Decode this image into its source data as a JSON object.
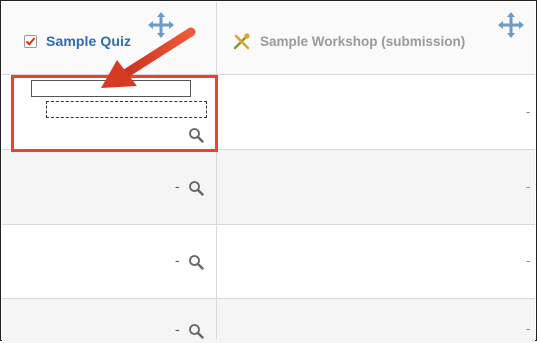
{
  "columns": {
    "quiz": {
      "title": "Sample Quiz",
      "icon": "checkbox-quiz-icon"
    },
    "workshop": {
      "title": "Sample Workshop (submission)",
      "icon": "workshop-icon"
    }
  },
  "rows": [
    {
      "quiz_value": "",
      "workshop_value": "-"
    },
    {
      "quiz_value": "-",
      "workshop_value": "-"
    },
    {
      "quiz_value": "-",
      "workshop_value": "-"
    },
    {
      "quiz_value": "-",
      "workshop_value": "-"
    }
  ],
  "colors": {
    "quiz_title": "#2a6cb5",
    "workshop_title": "#9a9a9a",
    "highlight": "#e8432c"
  }
}
